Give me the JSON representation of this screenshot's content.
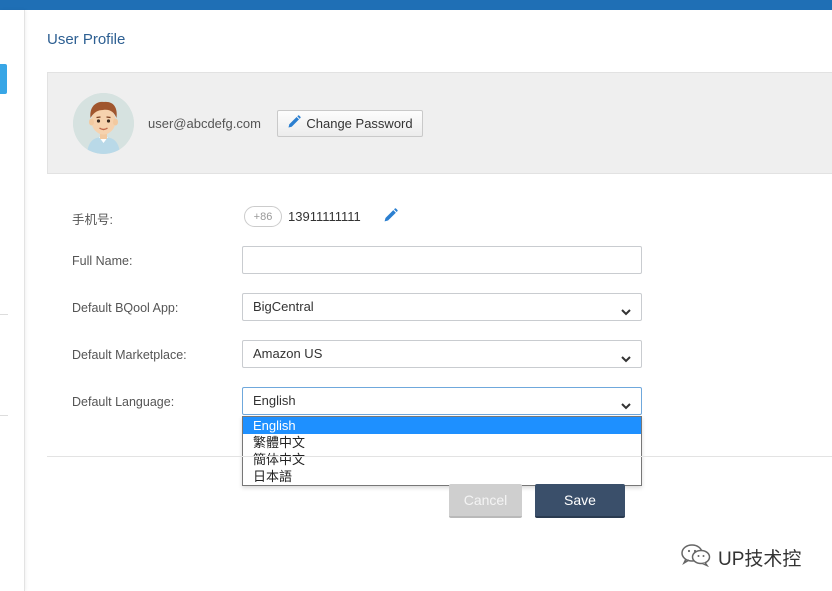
{
  "header": {
    "title": "User Profile"
  },
  "profile": {
    "email": "user@abcdefg.com",
    "change_password_label": "Change Password"
  },
  "form": {
    "phone": {
      "label": "手机号:",
      "country_code": "+86",
      "number": "13911111111"
    },
    "full_name": {
      "label": "Full Name:",
      "value": ""
    },
    "default_app": {
      "label": "Default BQool App:",
      "selected": "BigCentral"
    },
    "default_marketplace": {
      "label": "Default Marketplace:",
      "selected": "Amazon US"
    },
    "default_language": {
      "label": "Default Language:",
      "selected": "English",
      "options": [
        "English",
        "繁體中文",
        "簡体中文",
        "日本語"
      ]
    }
  },
  "actions": {
    "cancel_label": "Cancel",
    "save_label": "Save"
  },
  "watermark": {
    "text": "UP技术控"
  },
  "colors": {
    "topbar": "#1f6fb5",
    "title": "#2d5f92",
    "save_button": "#3a4f6a",
    "cancel_button": "#cfcfcf",
    "dropdown_highlight": "#1e90ff"
  },
  "icons": {
    "edit": "pencil-icon",
    "select_arrow": "chevron-down-icon",
    "avatar": "user-avatar",
    "watermark": "wechat-icon"
  }
}
